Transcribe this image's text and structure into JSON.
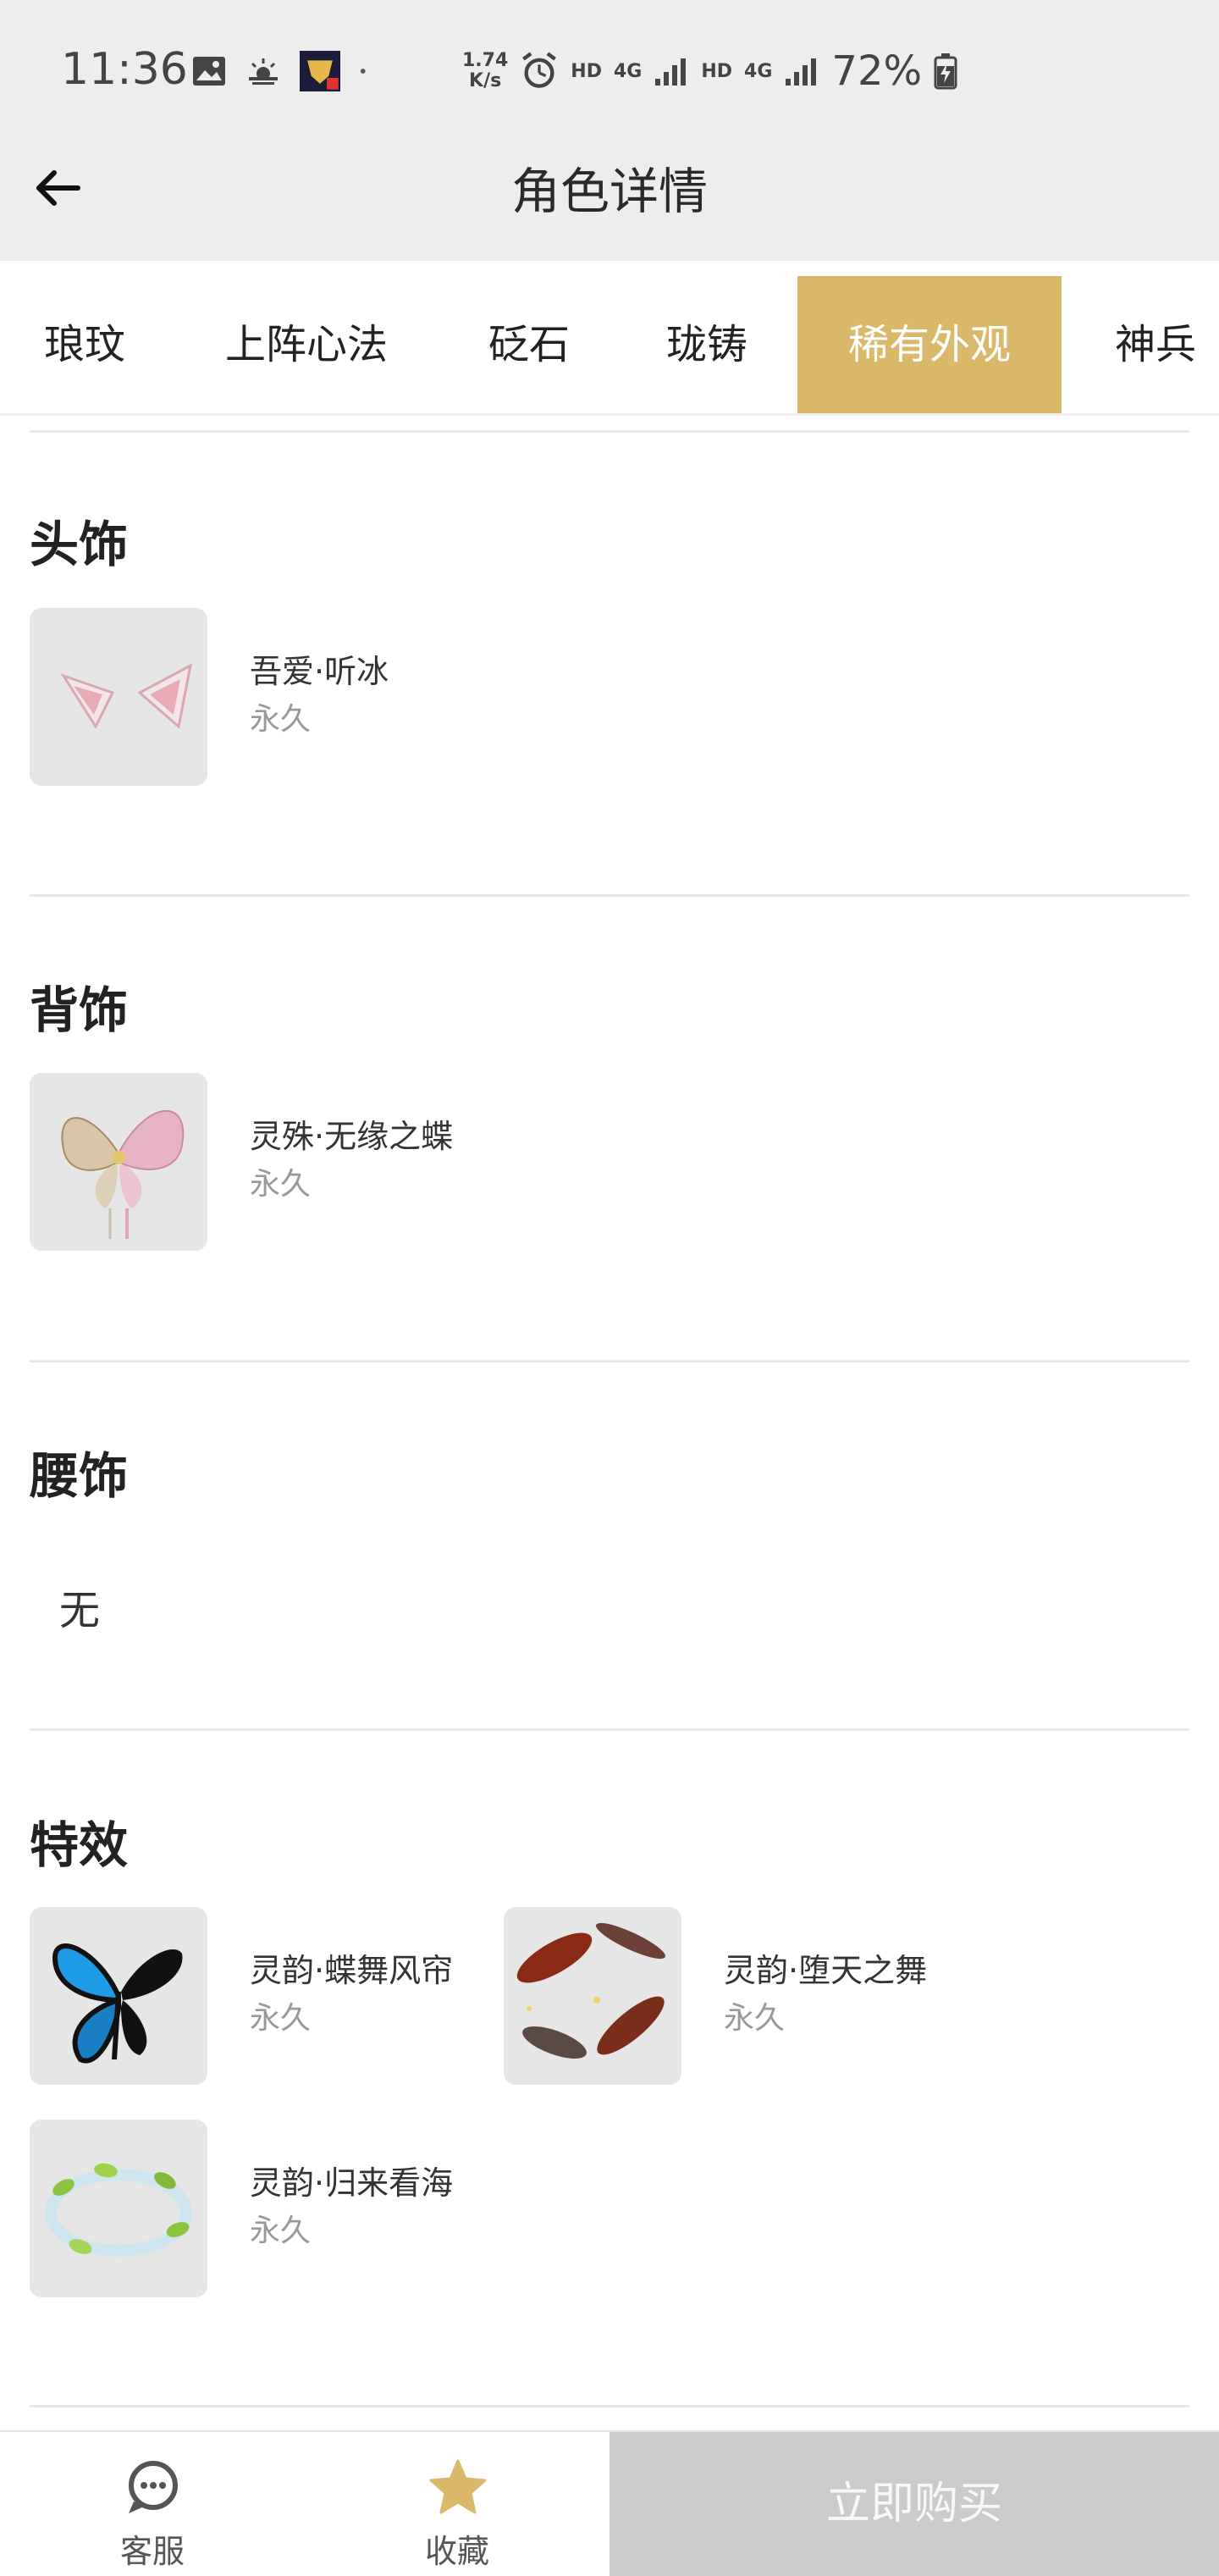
{
  "status_bar": {
    "time": "11:36",
    "net_speed_top": "1.74",
    "net_speed_bottom": "K/s",
    "hd1": "HD",
    "net1": "4G",
    "hd2": "HD",
    "net2": "4G",
    "battery": "72%",
    "icons": [
      "image-icon",
      "weather-icon",
      "app-notification-icon",
      "dot-icon",
      "alarm-icon",
      "signal-icon",
      "battery-charging-icon"
    ]
  },
  "header": {
    "title": "角色详情",
    "back_icon": "arrow-left-icon"
  },
  "tabs": [
    {
      "label": "琅玟",
      "active": false
    },
    {
      "label": "上阵心法",
      "active": false
    },
    {
      "label": "砭石",
      "active": false
    },
    {
      "label": "珑铸",
      "active": false
    },
    {
      "label": "稀有外观",
      "active": true
    },
    {
      "label": "神兵",
      "active": false
    }
  ],
  "sections": {
    "headwear": {
      "title": "头饰",
      "items": [
        {
          "name": "吾爱·听冰",
          "duration": "永久"
        }
      ]
    },
    "backwear": {
      "title": "背饰",
      "items": [
        {
          "name": "灵殊·无缘之蝶",
          "duration": "永久"
        }
      ]
    },
    "waist": {
      "title": "腰饰",
      "empty_text": "无"
    },
    "effects": {
      "title": "特效",
      "items": [
        {
          "name": "灵韵·蝶舞风帘",
          "duration": "永久"
        },
        {
          "name": "灵韵·堕天之舞",
          "duration": "永久"
        },
        {
          "name": "灵韵·归来看海",
          "duration": "永久"
        }
      ]
    }
  },
  "bottom_bar": {
    "service_label": "客服",
    "favorite_label": "收藏",
    "buy_label": "立即购买"
  },
  "colors": {
    "accent": "#dab96a",
    "buy_disabled": "#cbcbcb",
    "header_bg": "#ededed"
  }
}
